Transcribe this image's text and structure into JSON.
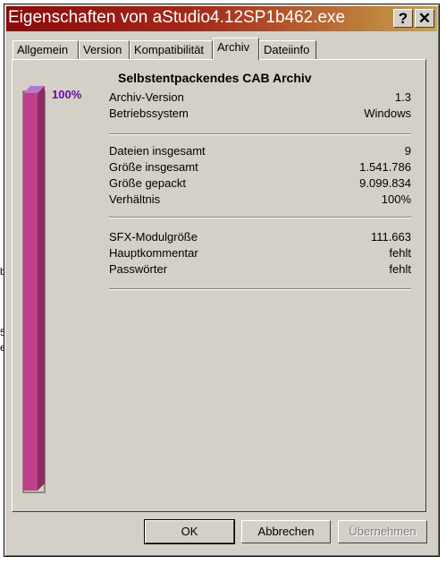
{
  "background_fragments": [
    "b",
    "5",
    "ei"
  ],
  "window": {
    "title": "Eigenschaften von aStudio4.12SP1b462.exe",
    "help_label": "?",
    "close_label": "✕"
  },
  "tabs": [
    {
      "label": "Allgemein",
      "active": false
    },
    {
      "label": "Version",
      "active": false
    },
    {
      "label": "Kompatibilität",
      "active": false
    },
    {
      "label": "Archiv",
      "active": true
    },
    {
      "label": "Dateiinfo",
      "active": false
    }
  ],
  "progress": {
    "label": "100%",
    "value": 1.0,
    "color": "#c0408a"
  },
  "archive": {
    "heading": "Selbstentpackendes CAB Archiv",
    "group1": [
      {
        "label": "Archiv-Version",
        "value": "1.3"
      },
      {
        "label": "Betriebssystem",
        "value": "Windows"
      }
    ],
    "group2": [
      {
        "label": "Dateien insgesamt",
        "value": "9"
      },
      {
        "label": "Größe insgesamt",
        "value": "1.541.786"
      },
      {
        "label": "Größe gepackt",
        "value": "9.099.834"
      },
      {
        "label": "Verhältnis",
        "value": "100%"
      }
    ],
    "group3": [
      {
        "label": "SFX-Modulgröße",
        "value": "111.663"
      },
      {
        "label": "Hauptkommentar",
        "value": "fehlt"
      },
      {
        "label": "Passwörter",
        "value": "fehlt"
      }
    ]
  },
  "buttons": {
    "ok": "OK",
    "cancel": "Abbrechen",
    "apply": "Übernehmen"
  }
}
